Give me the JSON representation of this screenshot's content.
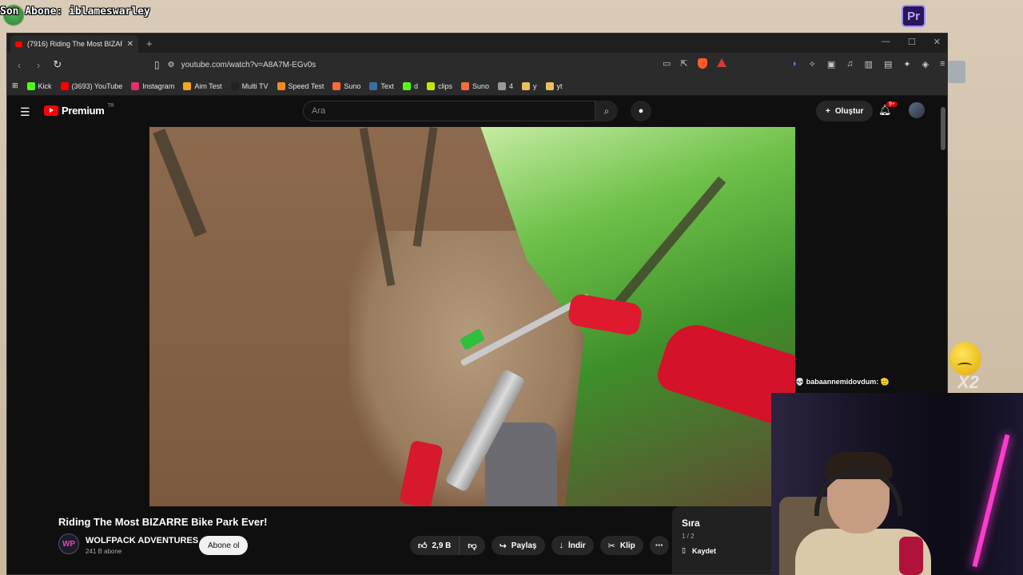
{
  "overlay": {
    "last_subscriber": "Son Abone: iblameswarley",
    "chat_message": "💀 babaannemidovdum: 🫡",
    "multiplier": "X2"
  },
  "desktop": {
    "premiere_icon": "Pr"
  },
  "browser": {
    "tab_title": "(7916) Riding The Most BIZARRE",
    "url": "youtube.com/watch?v=A8A7M-EGv0s",
    "bookmarks": [
      {
        "label": "Kick",
        "color": "#53fc18"
      },
      {
        "label": "(3693) YouTube",
        "color": "#ff0000"
      },
      {
        "label": "Instagram",
        "color": "#e1306c"
      },
      {
        "label": "Aim Test",
        "color": "#f5a623"
      },
      {
        "label": "Multi TV",
        "color": "#222222"
      },
      {
        "label": "Speed Test",
        "color": "#f08a24"
      },
      {
        "label": "Suno",
        "color": "#ff6a3d"
      },
      {
        "label": "Text",
        "color": "#3a6ea5"
      },
      {
        "label": "d",
        "color": "#53fc18"
      },
      {
        "label": "clips",
        "color": "#c8e600"
      },
      {
        "label": "Suno",
        "color": "#ff6a3d"
      },
      {
        "label": "4",
        "color": "#999999"
      },
      {
        "label": "y",
        "color": "#e8c15a"
      },
      {
        "label": "yt",
        "color": "#e8c15a"
      }
    ]
  },
  "youtube": {
    "brand": "Premium",
    "region": "TR",
    "search_placeholder": "Ara",
    "create_label": "Oluştur",
    "notif_badge": "9+",
    "video_title": "Riding The Most BIZARRE Bike Park Ever!",
    "channel_initials": "WP",
    "channel_name": "WOLFPACK ADVENTURES",
    "channel_subs": "241 B abone",
    "subscribe_label": "Abone ol",
    "likes": "2,9 B",
    "share_label": "Paylaş",
    "download_label": "İndir",
    "clip_label": "Klip",
    "queue_title": "Sıra",
    "queue_count": "1 / 2",
    "queue_save": "Kaydet"
  }
}
